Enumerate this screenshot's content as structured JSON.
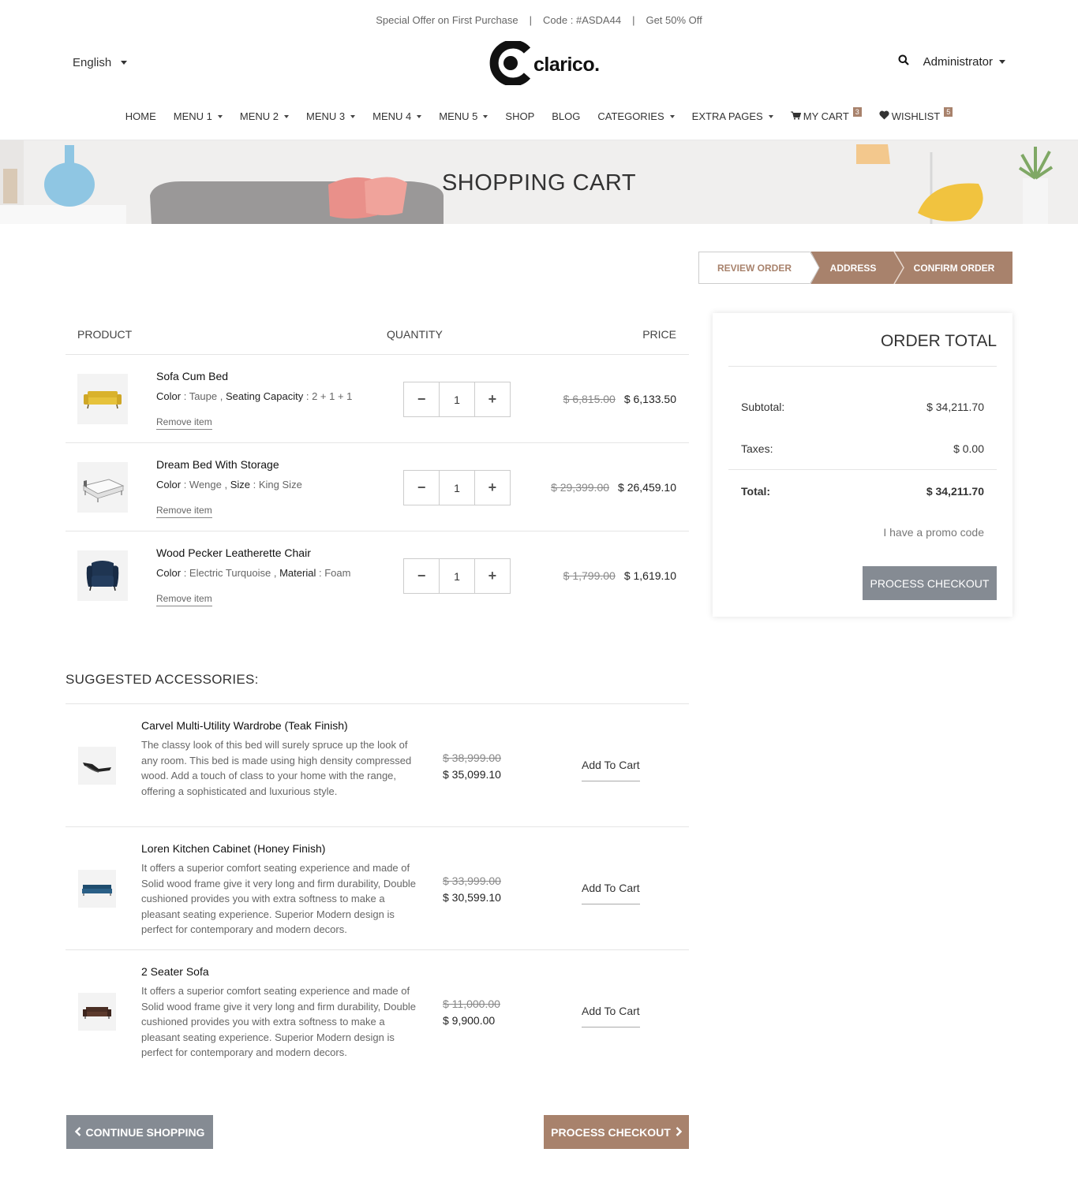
{
  "offer_bar": {
    "text1": "Special Offer on First Purchase",
    "text2": "Code : #ASDA44",
    "text3": "Get 50% Off",
    "separator": "|"
  },
  "header": {
    "language": "English",
    "logo_text": "clarico.",
    "user": "Administrator"
  },
  "nav": {
    "items": [
      {
        "label": "HOME",
        "dropdown": false
      },
      {
        "label": "MENU 1",
        "dropdown": true
      },
      {
        "label": "MENU 2",
        "dropdown": true
      },
      {
        "label": "MENU 3",
        "dropdown": true
      },
      {
        "label": "MENU 4",
        "dropdown": true
      },
      {
        "label": "MENU 5",
        "dropdown": true
      },
      {
        "label": "SHOP",
        "dropdown": false
      },
      {
        "label": "BLOG",
        "dropdown": false
      },
      {
        "label": "CATEGORIES",
        "dropdown": true
      },
      {
        "label": "EXTRA PAGES",
        "dropdown": true
      }
    ],
    "cart_label": "MY CART",
    "cart_count": "3",
    "wishlist_label": "WISHLIST",
    "wishlist_count": "5"
  },
  "banner": {
    "title": "SHOPPING CART"
  },
  "steps": {
    "review": "REVIEW ORDER",
    "address": "ADDRESS",
    "confirm": "CONFIRM ORDER"
  },
  "cart": {
    "headers": {
      "product": "PRODUCT",
      "quantity": "QUANTITY",
      "price": "PRICE"
    },
    "remove_label": "Remove item",
    "items": [
      {
        "name": "Sofa Cum Bed",
        "attr1_label": "Color",
        "attr1_value": "Taupe",
        "attr2_label": "Seating Capacity",
        "attr2_value": "2 + 1 + 1",
        "qty": "1",
        "old_price": "$ 6,815.00",
        "new_price": "$ 6,133.50",
        "image_icon": "yellow-sofa-icon"
      },
      {
        "name": "Dream Bed With Storage",
        "attr1_label": "Color",
        "attr1_value": "Wenge",
        "attr2_label": "Size",
        "attr2_value": "King Size",
        "qty": "1",
        "old_price": "$ 29,399.00",
        "new_price": "$ 26,459.10",
        "image_icon": "bed-icon"
      },
      {
        "name": "Wood Pecker Leatherette Chair",
        "attr1_label": "Color",
        "attr1_value": "Electric Turquoise",
        "attr2_label": "Material",
        "attr2_value": "Foam",
        "qty": "1",
        "old_price": "$ 1,799.00",
        "new_price": "$ 1,619.10",
        "image_icon": "armchair-icon"
      }
    ]
  },
  "order_total": {
    "title": "ORDER TOTAL",
    "subtotal_label": "Subtotal:",
    "subtotal_value": "$ 34,211.70",
    "taxes_label": "Taxes:",
    "taxes_value": "$ 0.00",
    "total_label": "Total:",
    "total_value": "$ 34,211.70",
    "promo": "I have a promo code",
    "checkout_button": "PROCESS CHECKOUT"
  },
  "accessories": {
    "title": "SUGGESTED ACCESSORIES:",
    "add_label": "Add To Cart",
    "items": [
      {
        "name": "Carvel Multi-Utility Wardrobe (Teak Finish)",
        "desc": "The classy look of this bed will surely spruce up the look of any room. This bed is made using high density compressed wood. Add a touch of class to your home with the range, offering a sophisticated and luxurious style.",
        "old_price": "$ 38,999.00",
        "new_price": "$ 35,099.10",
        "image_icon": "lounge-chair-icon"
      },
      {
        "name": "Loren Kitchen Cabinet (Honey Finish)",
        "desc": "It offers a superior comfort seating experience and made of Solid wood frame give it very long and firm durability, Double cushioned provides you with extra softness to make a pleasant seating experience. Superior Modern design is perfect for contemporary and modern decors.",
        "old_price": "$ 33,999.00",
        "new_price": "$ 30,599.10",
        "image_icon": "blue-sofa-icon"
      },
      {
        "name": "2 Seater Sofa",
        "desc": "It offers a superior comfort seating experience and made of Solid wood frame give it very long and firm durability, Double cushioned provides you with extra softness to make a pleasant seating experience. Superior Modern design is perfect for contemporary and modern decors.",
        "old_price": "$ 11,000.00",
        "new_price": "$ 9,900.00",
        "image_icon": "brown-sofa-icon"
      }
    ]
  },
  "footer_buttons": {
    "continue": "CONTINUE SHOPPING",
    "checkout": "PROCESS CHECKOUT"
  },
  "colors": {
    "accent": "#a8826c",
    "gray_button": "#858b93"
  }
}
